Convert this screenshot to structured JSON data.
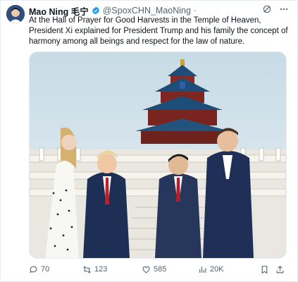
{
  "author": {
    "name": "Mao Ning 毛宁",
    "handle": "@SpoxCHN_MaoNing",
    "separator": "·"
  },
  "tweet": {
    "text": "At the Hall of Prayer for Good Harvests in the Temple of Heaven, President Xi explained for President Trump and his family the concept of harmony among all beings and respect for the law of nature."
  },
  "media": {
    "description_icon": "photo"
  },
  "actions": {
    "replies": "70",
    "retweets": "123",
    "likes": "585",
    "views": "20K"
  },
  "colors": {
    "accent": "#1d9bf0",
    "muted": "#536471",
    "text": "#0f1419"
  }
}
